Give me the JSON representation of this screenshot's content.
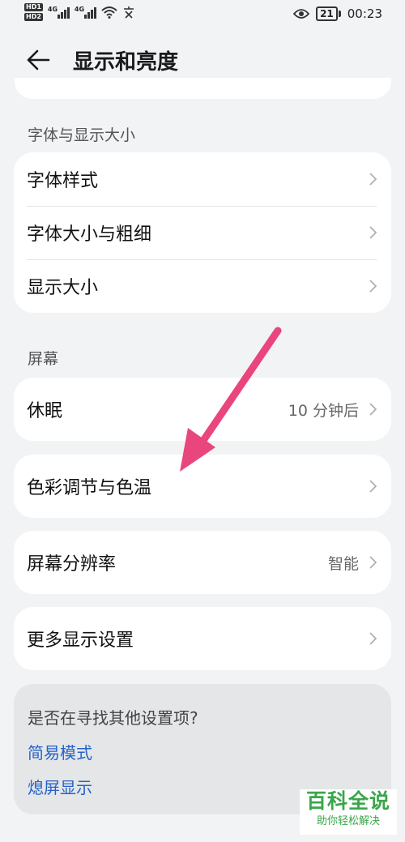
{
  "status_bar": {
    "hd_labels": [
      "HD1",
      "HD2"
    ],
    "network_labels": [
      "4G",
      "4G"
    ],
    "battery": "21",
    "time": "00:23"
  },
  "header": {
    "title": "显示和亮度"
  },
  "sections": {
    "font": {
      "label": "字体与显示大小",
      "items": [
        {
          "label": "字体样式"
        },
        {
          "label": "字体大小与粗细"
        },
        {
          "label": "显示大小"
        }
      ]
    },
    "screen": {
      "label": "屏幕",
      "sleep": {
        "label": "休眠",
        "value": "10 分钟后"
      },
      "color": {
        "label": "色彩调节与色温"
      },
      "resolution": {
        "label": "屏幕分辨率",
        "value": "智能"
      },
      "more": {
        "label": "更多显示设置"
      }
    }
  },
  "suggest": {
    "question": "是否在寻找其他设置项?",
    "links": [
      "简易模式",
      "熄屏显示"
    ]
  },
  "watermark": {
    "main": "百科全说",
    "sub": "助你轻松解决"
  },
  "colors": {
    "accent_link": "#2563c9",
    "arrow": "#e8467c",
    "watermark": "#3aa64a"
  }
}
